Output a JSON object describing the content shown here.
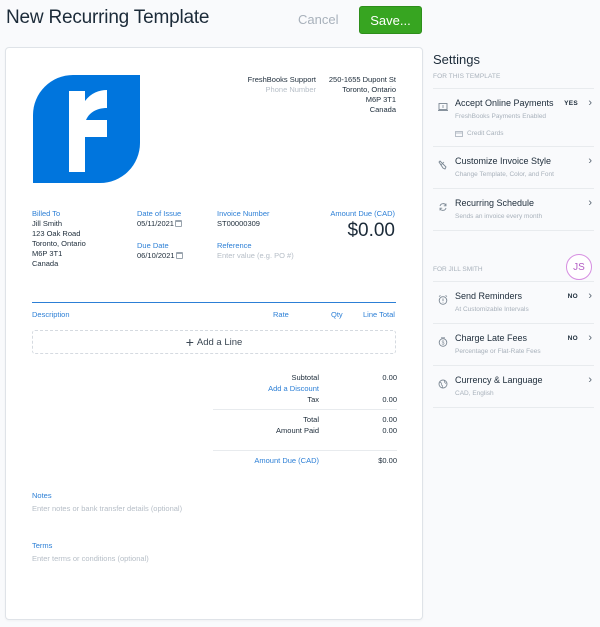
{
  "header": {
    "title": "New Recurring Template",
    "cancel_label": "Cancel",
    "save_label": "Save..."
  },
  "colors": {
    "brand_blue": "#0075dd",
    "accent_link": "#2c7fd6",
    "save_green": "#37a521",
    "avatar_purple": "#b35ec4"
  },
  "invoice": {
    "logo_icon": "freshbooks-logo",
    "company": {
      "name": "FreshBooks Support",
      "phone_placeholder": "Phone Number"
    },
    "address": [
      "250-1655 Dupont St",
      "Toronto, Ontario",
      "M6P 3T1",
      "Canada"
    ],
    "billed_to": {
      "label": "Billed To",
      "lines": [
        "Jill Smith",
        "123 Oak Road",
        "Toronto, Ontario",
        "M6P 3T1",
        "Canada"
      ]
    },
    "date_of_issue": {
      "label": "Date of Issue",
      "value": "05/11/2021"
    },
    "due_date": {
      "label": "Due Date",
      "value": "06/10/2021"
    },
    "invoice_number": {
      "label": "Invoice Number",
      "value": "ST00000309"
    },
    "reference": {
      "label": "Reference",
      "placeholder": "Enter value (e.g. PO #)"
    },
    "amount_due": {
      "label": "Amount Due (CAD)",
      "value": "$0.00"
    },
    "columns": [
      "Description",
      "Rate",
      "Qty",
      "Line Total"
    ],
    "add_line_label": "Add a Line",
    "totals": {
      "subtotal_label": "Subtotal",
      "subtotal": "0.00",
      "discount_link": "Add a Discount",
      "tax_label": "Tax",
      "tax": "0.00",
      "total_label": "Total",
      "total": "0.00",
      "paid_label": "Amount Paid",
      "paid": "0.00",
      "due_label": "Amount Due (CAD)",
      "due": "$0.00"
    },
    "notes": {
      "label": "Notes",
      "placeholder": "Enter notes or bank transfer details (optional)"
    },
    "terms": {
      "label": "Terms",
      "placeholder": "Enter terms or conditions (optional)"
    }
  },
  "settings": {
    "title": "Settings",
    "template_section": "FOR THIS TEMPLATE",
    "template_items": [
      {
        "icon": "online-payment-icon",
        "title": "Accept Online Payments",
        "subtitle": "FreshBooks Payments Enabled",
        "badge": "YES",
        "extra": "Credit Cards"
      },
      {
        "icon": "paint-brush-icon",
        "title": "Customize Invoice Style",
        "subtitle": "Change Template, Color, and Font"
      },
      {
        "icon": "recurring-icon",
        "title": "Recurring Schedule",
        "subtitle": "Sends an invoice every month"
      }
    ],
    "client_section": "FOR JILL SMITH",
    "avatar_initials": "JS",
    "client_items": [
      {
        "icon": "alarm-clock-icon",
        "title": "Send Reminders",
        "subtitle": "At Customizable Intervals",
        "badge": "NO"
      },
      {
        "icon": "late-fee-icon",
        "title": "Charge Late Fees",
        "subtitle": "Percentage or Flat-Rate Fees",
        "badge": "NO"
      },
      {
        "icon": "globe-icon",
        "title": "Currency & Language",
        "subtitle": "CAD, English"
      }
    ]
  }
}
